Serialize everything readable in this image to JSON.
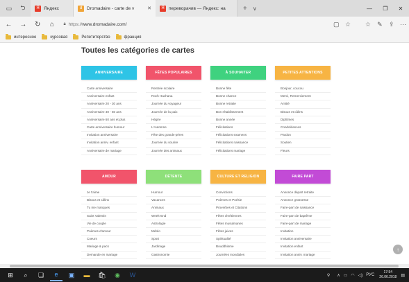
{
  "browser": {
    "tabs": [
      {
        "label": "Яндекс",
        "active": false,
        "color": "#e73c2a",
        "icon": "yandex-favicon",
        "glyph": "Я"
      },
      {
        "label": "Dromadaire - carte de v",
        "active": true,
        "color": "#f0a53a",
        "icon": "dromadaire-favicon",
        "glyph": "d"
      },
      {
        "label": "переворачив — Яндекс: на",
        "active": false,
        "color": "#e73c2a",
        "icon": "yandex-favicon",
        "glyph": "Я"
      }
    ],
    "url_protocol": "https://",
    "url_domain": "www.dromadaire.com/",
    "favorites": [
      "интересное",
      "курсовая",
      "Репетиторство",
      "франция"
    ]
  },
  "page": {
    "title": "Toutes les catégories de cartes",
    "categories": [
      {
        "title": "ANNIVERSAIRE",
        "color": "#2ec4e6",
        "items": [
          "Carte anniversaire",
          "Anniversaire enfant",
          "Anniversaire 20 - 30 ans",
          "Anniversaire 40 - 50 ans",
          "Anniversaire 60 ans et plus",
          "Carte anniversaire humour",
          "Invitation anniversaire",
          "Invitation anniv. enfant",
          "Anniversaire de mariage"
        ]
      },
      {
        "title": "FÊTES POPULAIRES",
        "color": "#f1546b",
        "items": [
          "Rentrée scolaire",
          "Roch Hachana",
          "Journée du voyageur",
          "Journée de la paix",
          "Hégire",
          "L'Automne",
          "Fête des grands-pères",
          "Journée du sourire",
          "Journée des animaux"
        ]
      },
      {
        "title": "À SOUHAITER",
        "color": "#3fd27f",
        "items": [
          "Bonne fête",
          "Bonne chance",
          "Bonne retraite",
          "Bon rétablissement",
          "Bonne année",
          "Félicitations",
          "Félicitations examens",
          "Félicitations naissance",
          "Félicitations mariage"
        ]
      },
      {
        "title": "PETITES ATTENTIONS",
        "color": "#f7b443",
        "items": [
          "Bonjour, coucou",
          "Merci, Remerciement",
          "Amitié",
          "Bisous et câlins",
          "Diplômes",
          "Condoléances",
          "Pardon",
          "Soutien",
          "Fleurs"
        ]
      },
      {
        "title": "AMOUR",
        "color": "#f1546b",
        "items": [
          "Je t'aime",
          "Bisous et câlins",
          "Tu me manques",
          "Saint Valentin",
          "Vie de couple",
          "Poèmes d'amour",
          "Coeurs",
          "Mariage & pacs",
          "Demande en mariage"
        ]
      },
      {
        "title": "DÉTENTE",
        "color": "#8ee07a",
        "items": [
          "Humour",
          "Vacances",
          "Animaux",
          "Week-End",
          "Astrologie",
          "Météo",
          "Sport",
          "Jardinage",
          "Gastronomie"
        ]
      },
      {
        "title": "CULTURE ET RELIGION",
        "color": "#f7b443",
        "items": [
          "Convictions",
          "Poèmes et Poésie",
          "Proverbes et Citations",
          "Fêtes chrétiennes",
          "Fêtes musulmanes",
          "Fêtes juives",
          "Spiritualité",
          "Bouddhisme",
          "Journées mondiales"
        ]
      },
      {
        "title": "FAIRE PART",
        "color": "#c24bd6",
        "items": [
          "Annonce départ retraite",
          "Annonce grossesse",
          "Faire-part de naissance",
          "Faire-part de baptême",
          "Faire-part de mariage",
          "Invitation",
          "Invitation anniversaire",
          "Invitation enfant",
          "Invitation anniv. mariage"
        ]
      }
    ]
  },
  "taskbar": {
    "language": "РУС",
    "time": "17:54",
    "date": "26.06.2018"
  }
}
